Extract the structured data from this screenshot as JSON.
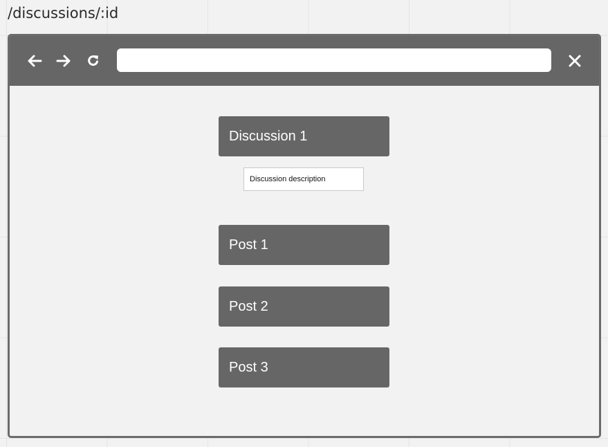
{
  "route": "/discussions/:id",
  "browser": {
    "url_value": "",
    "back_icon": "arrow-left-icon",
    "forward_icon": "arrow-right-icon",
    "reload_icon": "reload-icon",
    "close_icon": "close-icon"
  },
  "discussion": {
    "title": "Discussion 1",
    "description": "Discussion description"
  },
  "posts": [
    {
      "label": "Post 1"
    },
    {
      "label": "Post 2"
    },
    {
      "label": "Post 3"
    }
  ],
  "colors": {
    "canvas": "#f2f2f2",
    "toolbar": "#666666",
    "block": "#666666",
    "block_text": "#ffffff",
    "frame_border": "#6b6b6b"
  }
}
